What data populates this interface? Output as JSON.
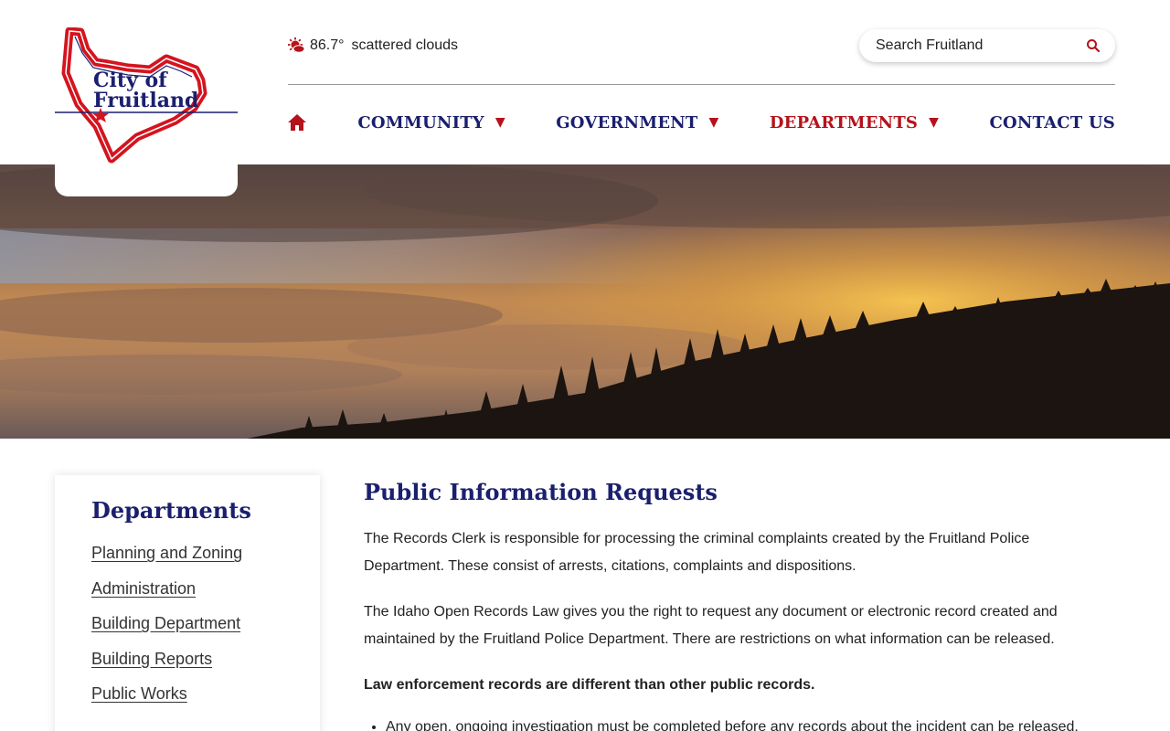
{
  "logo": {
    "line1": "City of",
    "line2": "Fruitland"
  },
  "weather": {
    "icon": "weather-icon",
    "temperature": "86.7°",
    "condition": "scattered clouds"
  },
  "search": {
    "placeholder": "Search Fruitland",
    "icon": "search-icon"
  },
  "nav": {
    "home_icon": "home-icon",
    "items": [
      {
        "label": "COMMUNITY",
        "caret": "▼"
      },
      {
        "label": "GOVERNMENT",
        "caret": "▼"
      },
      {
        "label": "DEPARTMENTS",
        "caret": "▼"
      },
      {
        "label": "CONTACT US"
      }
    ]
  },
  "sidebar": {
    "title": "Departments",
    "items": [
      "Planning and Zoning",
      "Administration",
      "Building Department",
      "Building Reports",
      "Public Works"
    ]
  },
  "main": {
    "title": "Public Information Requests",
    "paragraphs": [
      "The Records Clerk is responsible for processing the criminal complaints created by the Fruitland Police Department. These consist of arrests, citations, complaints and dispositions.",
      "The Idaho Open Records Law gives you the right to request any document or electronic record created and maintained by the Fruitland Police Department. There are restrictions on what information can be released."
    ],
    "bold_paragraph": "Law enforcement records are different than other public records.",
    "list": [
      "Any open, ongoing investigation must be completed before any records about the incident can be released."
    ]
  },
  "colors": {
    "navy": "#1a1f6e",
    "red": "#b5121b"
  }
}
